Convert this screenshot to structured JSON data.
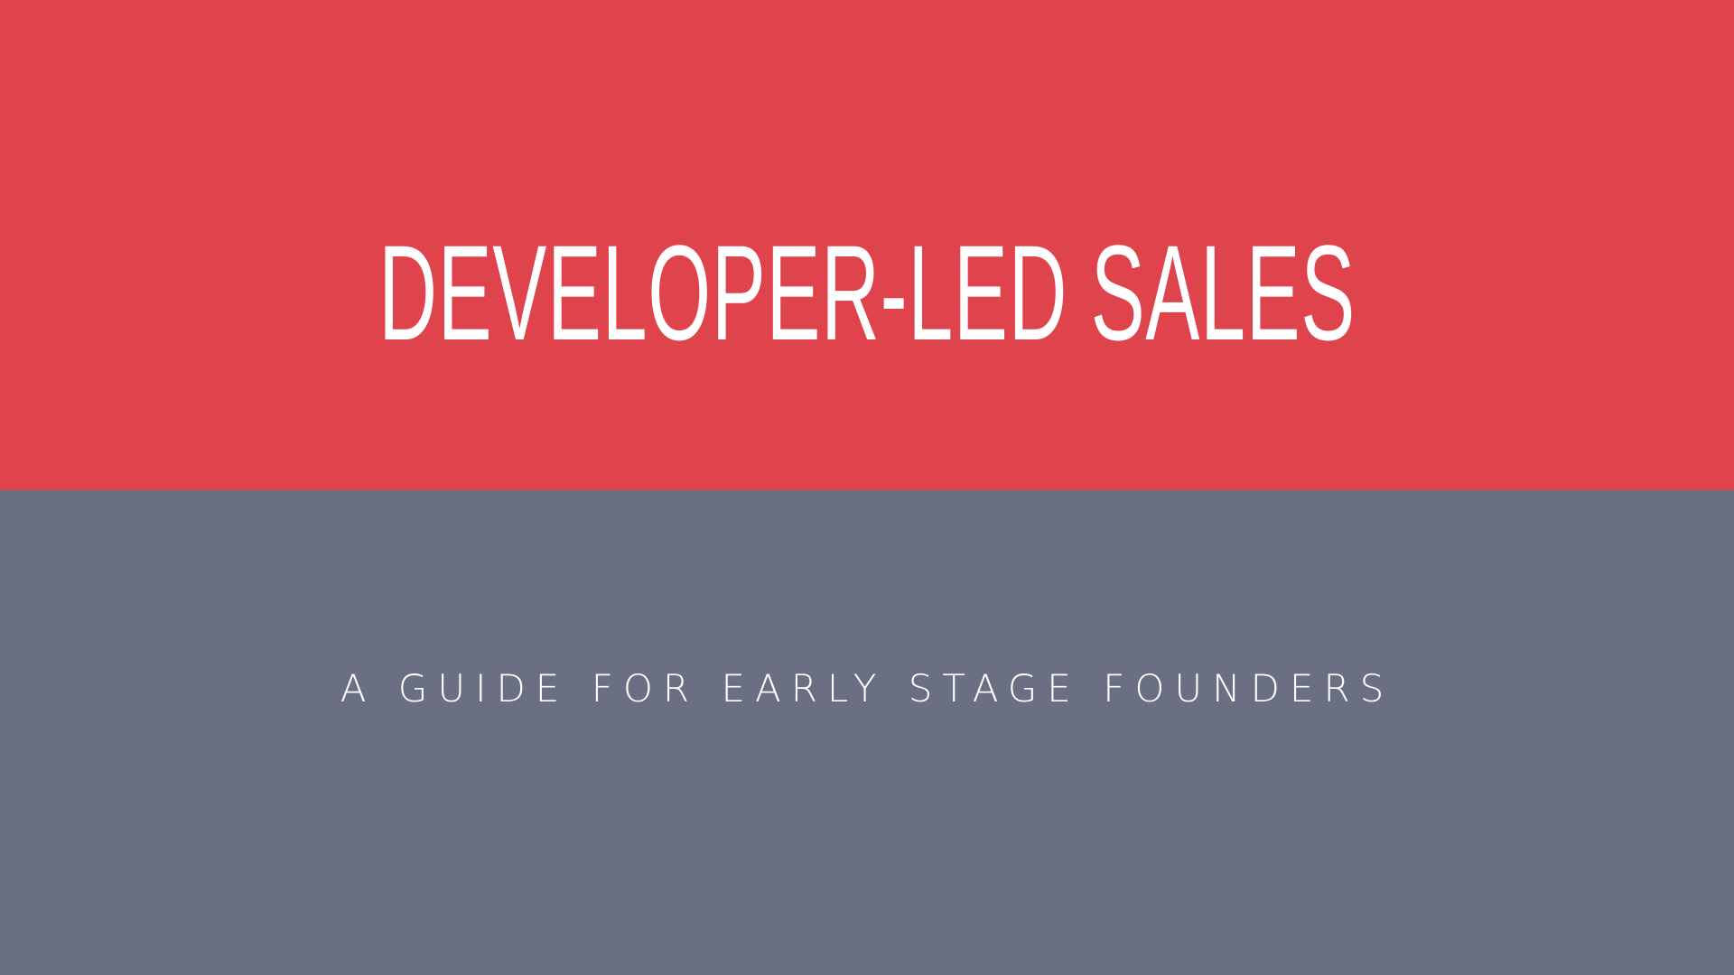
{
  "slide": {
    "title": "DEVELOPER-LED SALES",
    "subtitle": "A GUIDE FOR EARLY STAGE FOUNDERS"
  },
  "colors": {
    "top_band": "#df444c",
    "bottom_band": "#6a6f83",
    "text": "#ffffff"
  }
}
